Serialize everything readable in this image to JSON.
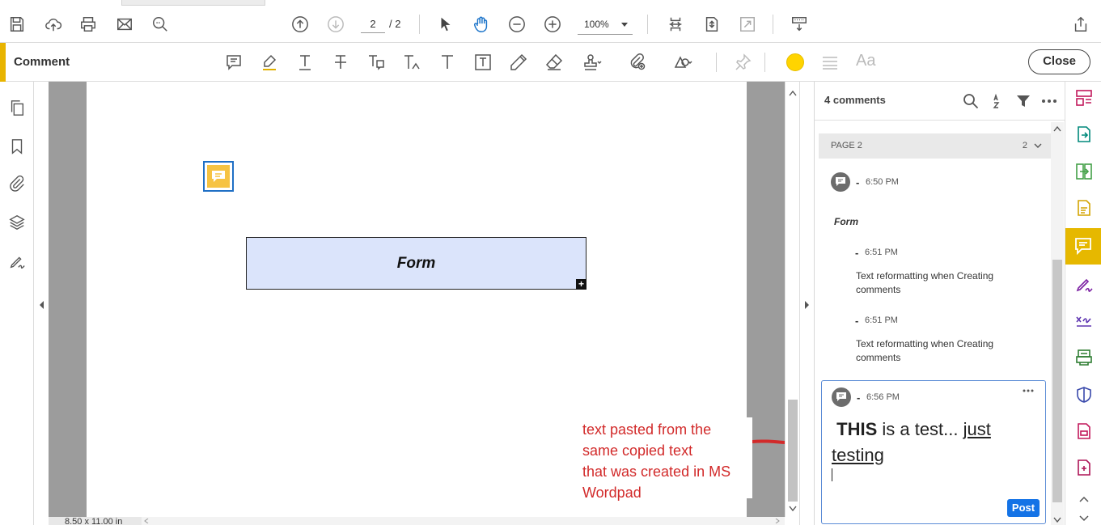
{
  "toolbar": {
    "current_page": "2",
    "total_pages": "/ 2",
    "zoom": "100%"
  },
  "comment_bar": {
    "title": "Comment",
    "close_label": "Close",
    "font_size_label": "Aa",
    "accent_color": "#e8b400",
    "highlight_color": "#ffd400"
  },
  "document": {
    "form_label": "Form",
    "form_plus": "+",
    "page_size": "8.50 x 11.00 in",
    "annotation_lines": [
      "text pasted from the",
      "same copied text",
      "that was created in MS",
      "Wordpad"
    ],
    "annotation_color": "#d22a2a"
  },
  "comments_panel": {
    "count_label": "4 comments",
    "page_header": "PAGE 2",
    "page_count": "2",
    "comments": [
      {
        "dash": "-",
        "time": "6:50 PM",
        "text": "Form"
      },
      {
        "dash": "-",
        "time": "6:51 PM",
        "text": "Text reformatting when Creating comments"
      },
      {
        "dash": "-",
        "time": "6:51 PM",
        "text": "Text reformatting when Creating comments"
      },
      {
        "dash": "-",
        "time": "6:56 PM",
        "text_bold": "THIS",
        "text_mid": " is a test... ",
        "text_underline": "just testing"
      }
    ],
    "post_label": "Post",
    "post_color": "#1473e6"
  }
}
